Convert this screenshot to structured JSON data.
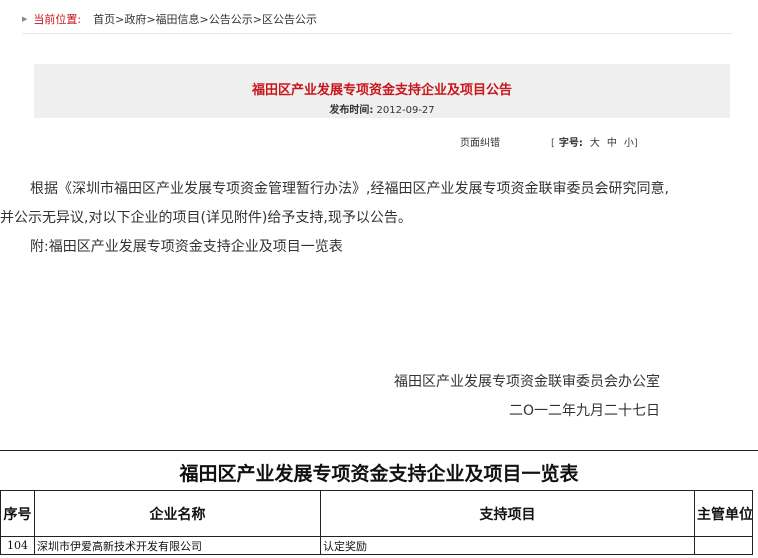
{
  "breadcrumb": {
    "label": "当前位置:",
    "items": [
      "首页",
      "政府",
      "福田信息",
      "公告公示",
      "区公告公示"
    ],
    "separator": ">"
  },
  "article": {
    "title": "福田区产业发展专项资金支持企业及项目公告",
    "publish_label": "发布时间:",
    "publish_date": "2012-09-27",
    "correction_link": "页面纠错",
    "font_size_label": "字号:",
    "font_sizes": [
      "大",
      "中",
      "小"
    ],
    "bracket_open": "[",
    "bracket_close": "]",
    "paragraphs": [
      "根据《深圳市福田区产业发展专项资金管理暂行办法》,经福田区产业发展专项资金联审委员会研究同意,并公示无异议,对以下企业的项目(详见附件)给予支持,现予以公告。",
      "附:福田区产业发展专项资金支持企业及项目一览表"
    ],
    "signature_org": "福田区产业发展专项资金联审委员会办公室",
    "signature_date": "二O一二年九月二十七日"
  },
  "table": {
    "title": "福田区产业发展专项资金支持企业及项目一览表",
    "headers": [
      "序号",
      "企业名称",
      "支持项目",
      "主管单位"
    ],
    "rows": [
      [
        "104",
        "深圳市伊爱高新技术开发有限公司",
        "认定奖励",
        ""
      ]
    ]
  },
  "colors": {
    "accent_red": "#c8161d",
    "title_box_bg": "#efefef"
  },
  "icons": {
    "breadcrumb_marker": "triangle-right-icon"
  }
}
